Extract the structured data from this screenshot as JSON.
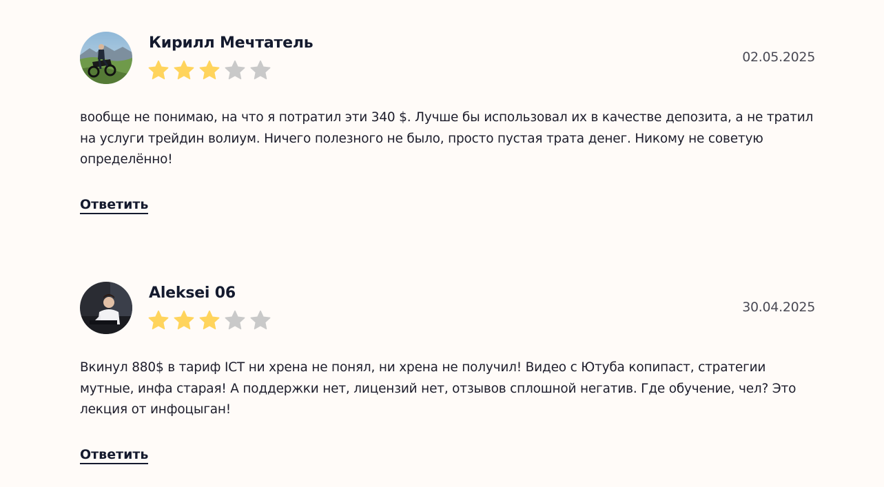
{
  "colors": {
    "background": "#fffbf8",
    "star_filled": "#ffd45c",
    "star_empty": "#c9c9c9",
    "text_dark": "#141a2e"
  },
  "reviews": [
    {
      "author": "Кирилл Мечтатель",
      "date": "02.05.2025",
      "rating": 3,
      "max_rating": 5,
      "text": "вообще не понимаю, на что я потратил эти 340 $. Лучше бы использовал их в качестве депозита, а не тратил на услуги трейдин волиум. Ничего полезного не было, просто пустая трата денег. Никому не советую определённо!",
      "reply_label": "Ответить",
      "avatar_icon": "avatar-photo-icon"
    },
    {
      "author": "Aleksei 06",
      "date": "30.04.2025",
      "rating": 3,
      "max_rating": 5,
      "text": "Вкинул 880$ в тариф ICT ни хрена не понял, ни хрена не получил! Видео с Ютуба копипаст, стратегии мутные, инфа старая! А поддержки нет, лицензий нет, отзывов сплошной негатив. Где обучение, чел? Это лекция от инфоцыган!",
      "reply_label": "Ответить",
      "avatar_icon": "avatar-photo-icon"
    }
  ]
}
